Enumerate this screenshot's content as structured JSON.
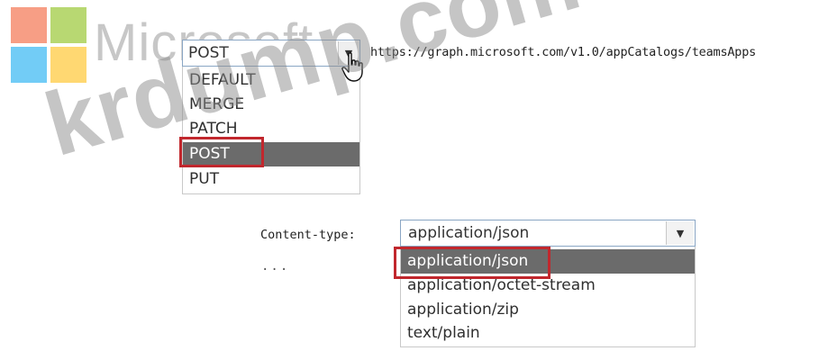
{
  "brand": {
    "wordmark": "Microsoft",
    "logo_colors": [
      "#f25022",
      "#7fba00",
      "#00a4ef",
      "#ffb900"
    ]
  },
  "watermark": {
    "text": "krdump.com"
  },
  "request": {
    "method_select": {
      "value": "POST",
      "options": [
        "DEFAULT",
        "MERGE",
        "PATCH",
        "POST",
        "PUT"
      ],
      "selected_option": "POST"
    },
    "url": "https://graph.microsoft.com/v1.0/appCatalogs/teamsApps"
  },
  "content_type": {
    "label": "Content-type:",
    "select": {
      "value": "application/json",
      "options": [
        "application/json",
        "application/octet-stream",
        "application/zip",
        "text/plain"
      ],
      "selected_option": "application/json"
    }
  },
  "ellipsis": "...",
  "colors": {
    "highlight": "#c1272d",
    "selected_bg": "#6b6b6b",
    "select_border": "#8aa6c4"
  },
  "icons": {
    "method_dropdown_arrow": "triangle-down-icon",
    "content_type_dropdown_arrow": "triangle-down-icon",
    "cursor": "hand-pointer-icon"
  }
}
